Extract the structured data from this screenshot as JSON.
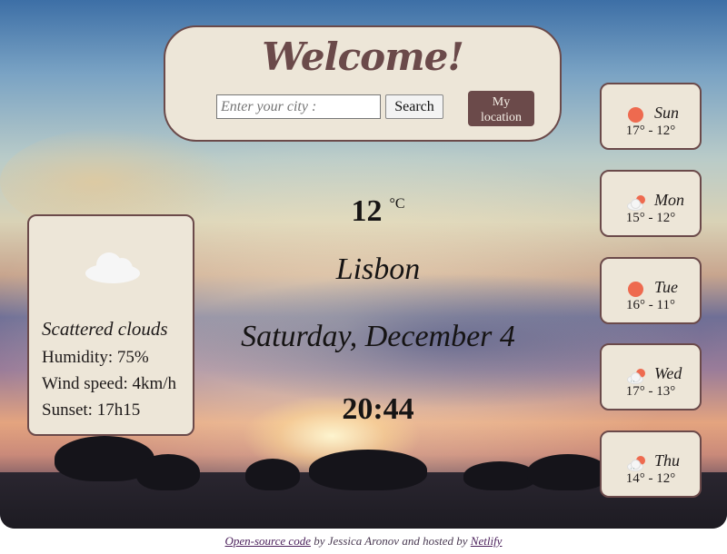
{
  "header": {
    "title": "Welcome!",
    "search_placeholder": "Enter your city :",
    "search_label": "Search",
    "location_label_line1": "My",
    "location_label_line2": "location"
  },
  "current": {
    "temperature": "12",
    "unit": "°C",
    "city": "Lisbon",
    "date": "Saturday, December 4",
    "time": "20:44",
    "icon": "cloud-icon",
    "description": "Scattered clouds",
    "humidity": "Humidity: 75%",
    "wind": "Wind speed: 4km/h",
    "sunset": "Sunset: 17h15"
  },
  "forecast": [
    {
      "day": "Sun",
      "range": "17° - 12°",
      "icon": "sun-icon"
    },
    {
      "day": "Mon",
      "range": "15° - 12°",
      "icon": "sun-cloud-icon"
    },
    {
      "day": "Tue",
      "range": "16° - 11°",
      "icon": "sun-icon"
    },
    {
      "day": "Wed",
      "range": "17° - 13°",
      "icon": "rain-sun-icon"
    },
    {
      "day": "Thu",
      "range": "14° - 12°",
      "icon": "rain-sun-icon"
    }
  ],
  "footer": {
    "link_text": "Open-source code",
    "by_text": "by Jessica Aronov and hosted by",
    "host_link": "Netlify"
  },
  "colors": {
    "panel_bg": "#ede6d8",
    "accent": "#6b4a4a",
    "sun": "#ee6a4f"
  }
}
